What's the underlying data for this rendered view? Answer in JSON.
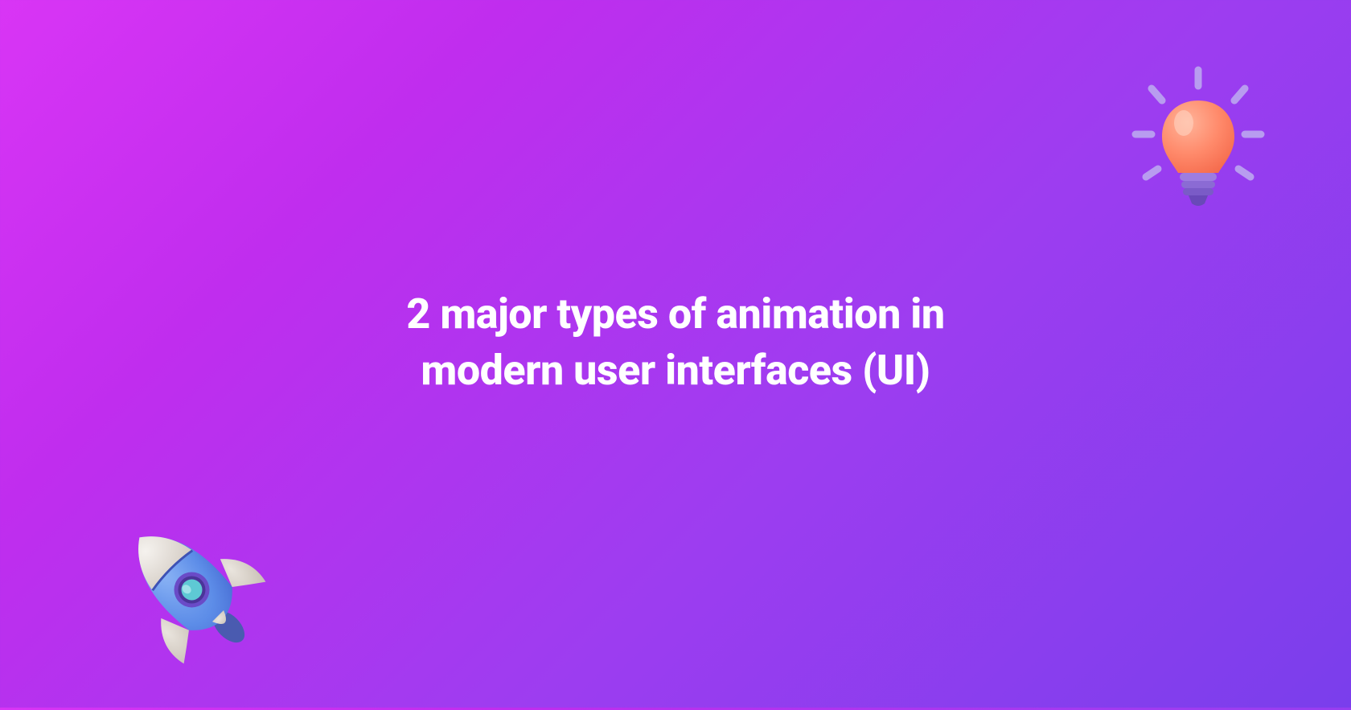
{
  "hero": {
    "title": "2 major types of animation in modern user interfaces (UI)"
  },
  "icons": {
    "rocket": "rocket-icon",
    "lightbulb": "lightbulb-icon"
  },
  "colors": {
    "gradient_start": "#d935f5",
    "gradient_end": "#7a3eec",
    "text": "#ffffff"
  }
}
